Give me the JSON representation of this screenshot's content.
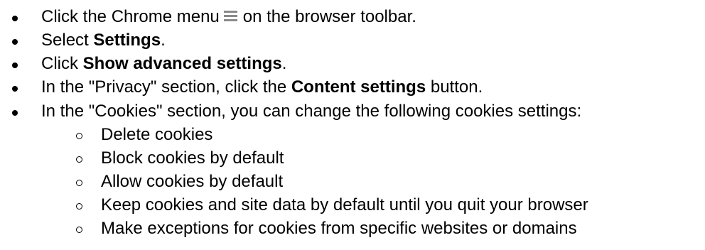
{
  "steps": [
    {
      "before": "Click the Chrome menu",
      "icon": "hamburger-menu-icon",
      "after": "on the browser toolbar."
    },
    {
      "before": "Select ",
      "bold": "Settings",
      "after": "."
    },
    {
      "before": "Click ",
      "bold": "Show advanced settings",
      "after": "."
    },
    {
      "before": "In the \"Privacy\" section, click the ",
      "bold": "Content settings",
      "after": " button."
    },
    {
      "text": "In the \"Cookies\" section, you can change the following cookies settings:"
    }
  ],
  "cookie_options": [
    "Delete cookies",
    "Block cookies by default",
    "Allow cookies by default",
    "Keep cookies and site data by default until you quit your browser",
    "Make exceptions for cookies from specific websites or domains"
  ]
}
